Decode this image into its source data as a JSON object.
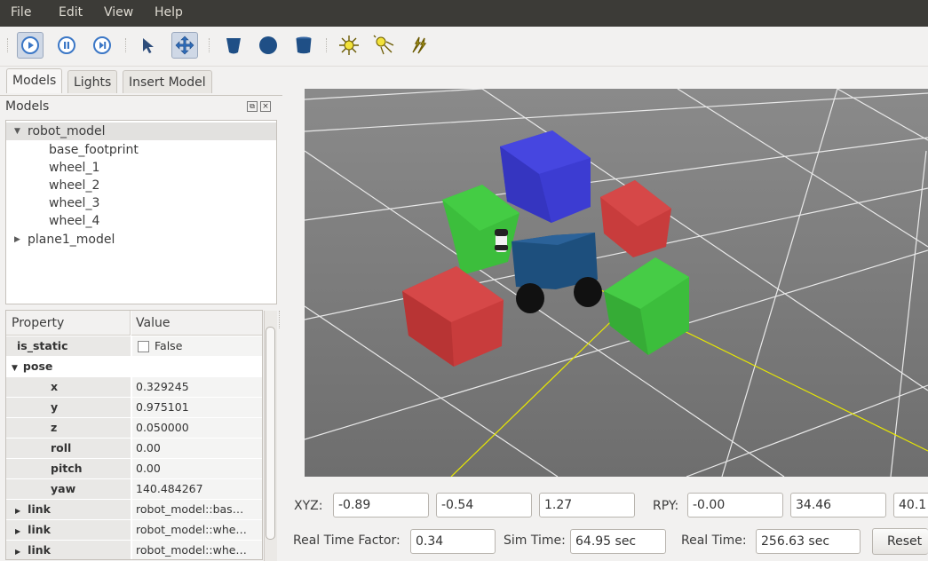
{
  "menu": {
    "file": "File",
    "edit": "Edit",
    "view": "View",
    "help": "Help"
  },
  "toolbar": {
    "icons": [
      "play-icon",
      "pause-icon",
      "step-icon",
      "select-arrow-icon",
      "translate-icon",
      "cylinder-icon",
      "sphere-icon",
      "box-icon",
      "point-light-icon",
      "spot-light-icon",
      "directional-light-icon"
    ]
  },
  "tabs": {
    "models": "Models",
    "lights": "Lights",
    "insert": "Insert Model"
  },
  "models_panel": {
    "title": "Models"
  },
  "tree": {
    "robot": "robot_model",
    "children": [
      "base_footprint",
      "wheel_1",
      "wheel_2",
      "wheel_3",
      "wheel_4"
    ],
    "plane": "plane1_model"
  },
  "properties": {
    "col_property": "Property",
    "col_value": "Value",
    "is_static_label": "is_static",
    "is_static_value": "False",
    "pose_label": "pose",
    "x_label": "x",
    "x_value": "0.329245",
    "y_label": "y",
    "y_value": "0.975101",
    "z_label": "z",
    "z_value": "0.050000",
    "roll_label": "roll",
    "roll_value": "0.00",
    "pitch_label": "pitch",
    "pitch_value": "0.00",
    "yaw_label": "yaw",
    "yaw_value": "140.484267",
    "link_label": "link",
    "link1_value": "robot_model::bas…",
    "link2_value": "robot_model::whe…",
    "link3_value": "robot_model::whe…"
  },
  "camera": {
    "xyz_label": "XYZ:",
    "x": "-0.89",
    "y": "-0.54",
    "z": "1.27",
    "rpy_label": "RPY:",
    "r": "-0.00",
    "p": "34.46",
    "yw": "40.1"
  },
  "status": {
    "rtf_label": "Real Time Factor:",
    "rtf_value": "0.34",
    "sim_label": "Sim Time:",
    "sim_value": "64.95 sec",
    "real_label": "Real Time:",
    "real_value": "256.63 sec",
    "reset": "Reset"
  },
  "colors": {
    "menubar": "#3c3b37",
    "viewport_bg": "#7f7f7f",
    "red_box": "#c83c3c",
    "green_box": "#3cbe3c",
    "blue_box": "#3c3cd2",
    "robot_body": "#1d4f7d"
  }
}
